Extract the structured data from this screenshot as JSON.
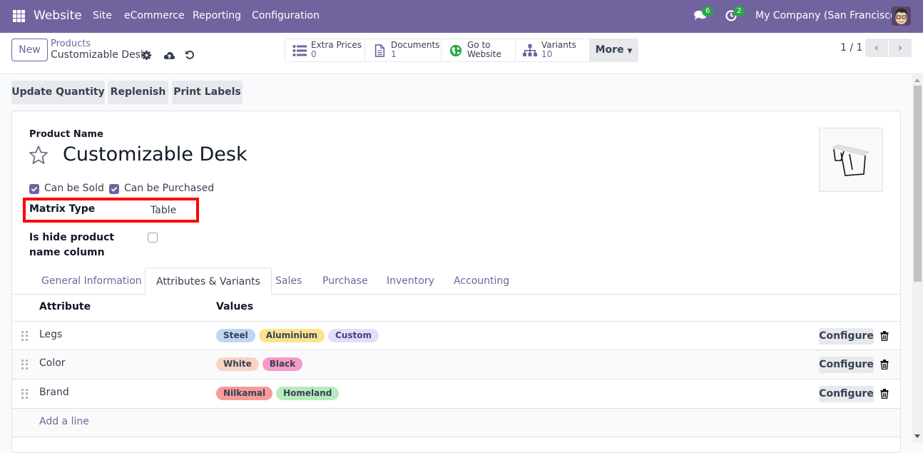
{
  "navbar": {
    "app_name": "Website",
    "menu": [
      "Site",
      "eCommerce",
      "Reporting",
      "Configuration"
    ],
    "messages_count": "6",
    "activities_count": "2",
    "company": "My Company (San Francisco)",
    "icons": [
      "apps-grid-icon",
      "chat-icon",
      "clock-icon",
      "user-avatar"
    ]
  },
  "control_panel": {
    "new_label": "New",
    "breadcrumb_parent": "Products",
    "breadcrumb_current": "Customizable Desk",
    "icons": [
      "gear-icon",
      "cloud-upload-icon",
      "undo-icon"
    ],
    "smart_buttons": [
      {
        "label": "Extra Prices",
        "value": "0",
        "icon": "list-icon"
      },
      {
        "label": "Documents",
        "value": "1",
        "icon": "document-icon"
      },
      {
        "label": "Go to",
        "value": "Website",
        "icon": "globe-icon"
      },
      {
        "label": "Variants",
        "value": "10",
        "icon": "sitemap-icon"
      }
    ],
    "more_label": "More",
    "pager": "1 / 1",
    "pager_prev": "‹",
    "pager_next": "›"
  },
  "actions": [
    "Update Quantity",
    "Replenish",
    "Print Labels"
  ],
  "form": {
    "product_name_label": "Product Name",
    "product_name": "Customizable Desk",
    "can_be_sold_label": "Can be Sold",
    "can_be_sold": true,
    "can_be_purchased_label": "Can be Purchased",
    "can_be_purchased": true,
    "matrix_type_label": "Matrix Type",
    "matrix_type_value": "Table",
    "hide_product_name_label": "Is hide product name column",
    "hide_product_name": false
  },
  "tabs": [
    {
      "label": "General Information",
      "active": false
    },
    {
      "label": "Attributes & Variants",
      "active": true
    },
    {
      "label": "Sales",
      "active": false
    },
    {
      "label": "Purchase",
      "active": false
    },
    {
      "label": "Inventory",
      "active": false
    },
    {
      "label": "Accounting",
      "active": false
    }
  ],
  "attributes_table": {
    "headers": [
      "Attribute",
      "Values"
    ],
    "rows": [
      {
        "attribute": "Legs",
        "values": [
          {
            "label": "Steel",
            "color": "#bcd6f6"
          },
          {
            "label": "Aluminium",
            "color": "#fbe38e"
          },
          {
            "label": "Custom",
            "color": "#e5dcf9"
          }
        ]
      },
      {
        "attribute": "Color",
        "values": [
          {
            "label": "White",
            "color": "#f8d4c5"
          },
          {
            "label": "Black",
            "color": "#f49ac8"
          }
        ]
      },
      {
        "attribute": "Brand",
        "values": [
          {
            "label": "Nilkamal",
            "color": "#f79a9a"
          },
          {
            "label": "Homeland",
            "color": "#b7eabd"
          }
        ]
      }
    ],
    "configure_label": "Configure",
    "add_line_label": "Add a line"
  }
}
